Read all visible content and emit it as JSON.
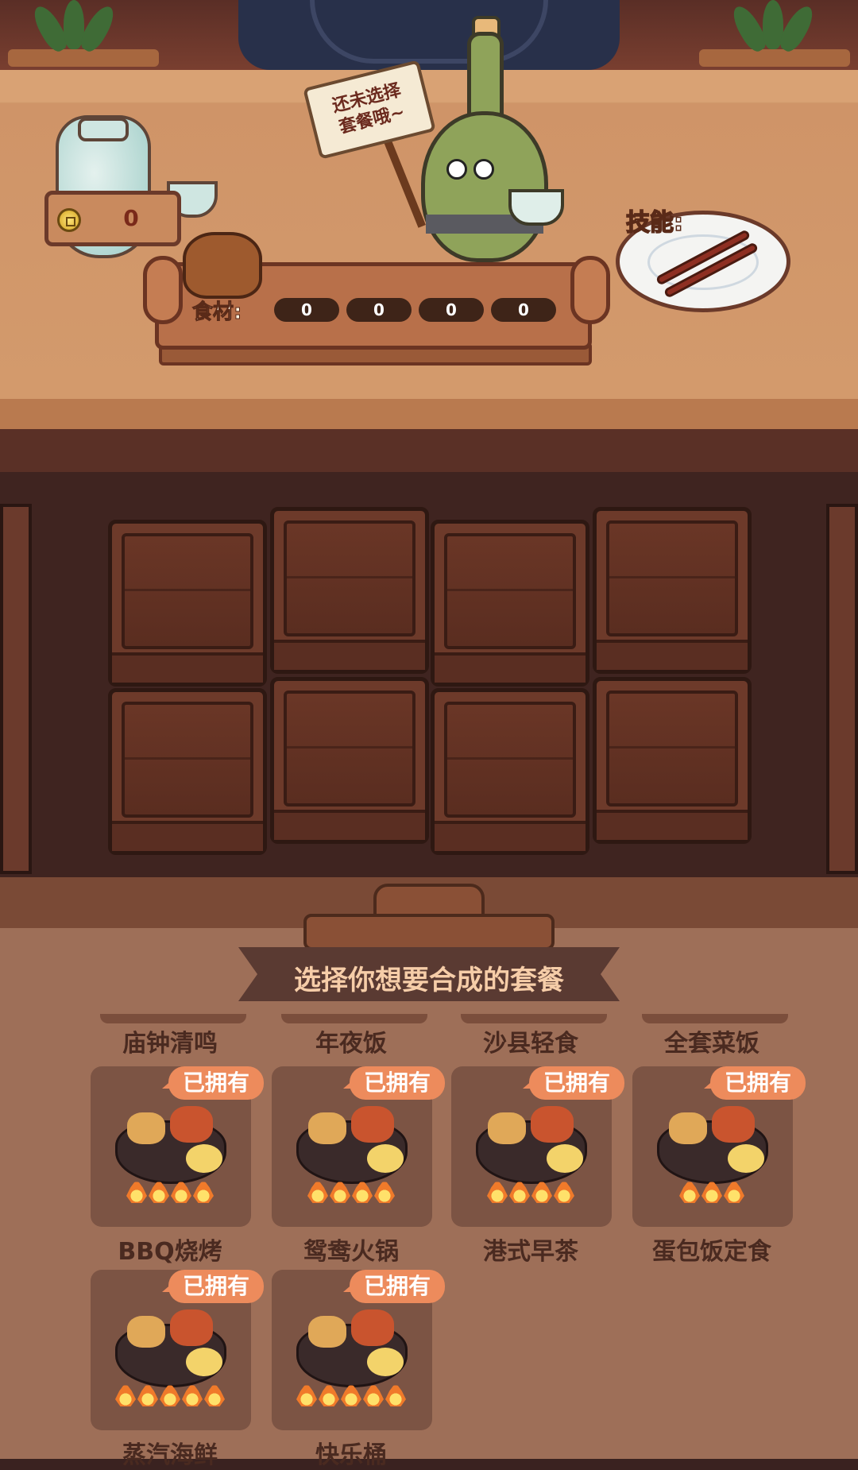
{
  "header": {
    "coin_count": "0",
    "speech_sign": "还未选择\n套餐哦~",
    "skill_label": "技能:",
    "ingredient_label": "食材:",
    "ingredients": [
      "0",
      "0",
      "0",
      "0"
    ]
  },
  "panel": {
    "title": "选择你想要合成的套餐",
    "tab_names": [
      "庙钟清鸣",
      "年夜饭",
      "沙县轻食",
      "全套菜饭"
    ],
    "meals": [
      {
        "name": "BBQ烧烤",
        "badge": "已拥有",
        "flames": 4
      },
      {
        "name": "鸳鸯火锅",
        "badge": "已拥有",
        "flames": 4
      },
      {
        "name": "港式早茶",
        "badge": "已拥有",
        "flames": 4
      },
      {
        "name": "蛋包饭定食",
        "badge": "已拥有",
        "flames": 3
      },
      {
        "name": "蒸汽海鲜",
        "badge": "已拥有",
        "flames": 5
      },
      {
        "name": "快乐桶",
        "badge": "已拥有",
        "flames": 5
      }
    ]
  },
  "colors": {
    "badge": "#ed8b5c",
    "panel": "#9e6f58",
    "card": "#7c5444",
    "ribbon": "#5a3a32"
  }
}
